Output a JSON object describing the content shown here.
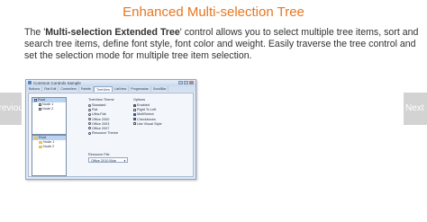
{
  "title": "Enhanced Multi-selection Tree",
  "description": {
    "prefix": "The '",
    "bold": "Multi-selection Extended Tree",
    "suffix": "' control allows you to select multiple tree items, sort and search tree items, define font style, font color and weight.  Easily traverse the tree control and set the selection mode for multiple tree item selection."
  },
  "nav": {
    "prev": "Previous",
    "next": "Next"
  },
  "window": {
    "title": "Common Controls Sample",
    "tabs": [
      "Buttons",
      "Flat Edit",
      "Controllers",
      "Palette",
      "TreeView",
      "ListView",
      "Progressbar",
      "ScrollBar"
    ],
    "active_tab": "TreeView",
    "tree1": {
      "root": "Root",
      "children": [
        "Node 1",
        "Node 2"
      ]
    },
    "tree2": {
      "root": "Root",
      "children": [
        "Node 1",
        "Node 2"
      ]
    },
    "theme_label": "TreeView Theme",
    "themes": [
      "Standard",
      "Flat",
      "Ultra-Flat",
      "Office 2000",
      "Office 2003",
      "Office 2007",
      "Resource Theme"
    ],
    "selected_theme": "Resource Theme",
    "options_label": "Options",
    "options": [
      "Enabled",
      "Right To Left",
      "MultiSelect",
      "Checkboxes",
      "Use Visual Style"
    ],
    "checked_options": [
      "Enabled",
      "MultiSelect",
      "Checkboxes"
    ],
    "resource_label": "Resource File:",
    "resource_value": "Office 2010 Blue"
  }
}
